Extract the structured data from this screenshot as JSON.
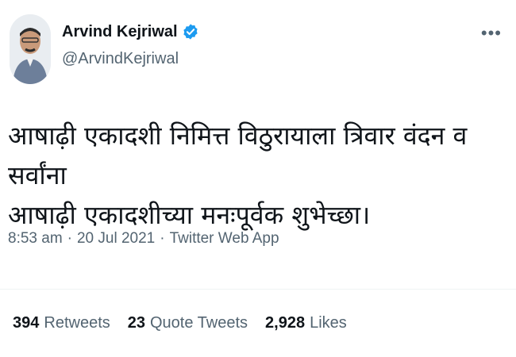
{
  "author": {
    "display_name": "Arvind Kejriwal",
    "handle": "@ArvindKejriwal",
    "verified": true,
    "verified_icon": "verified-badge-icon",
    "avatar_icon": "avatar"
  },
  "menu": {
    "more_icon": "more-horizontal-icon",
    "label": "•••"
  },
  "tweet": {
    "lines": [
      "आषाढ़ी एकादशी निमित्त विठुरायाला त्रिवार वंदन व सर्वांना",
      "आषाढ़ी एकादशीच्या मनःपूर्वक शुभेच्छा।"
    ]
  },
  "meta": {
    "time": "8:53 am",
    "sep1": "·",
    "date": "20 Jul 2021",
    "sep2": "·",
    "source": "Twitter Web App"
  },
  "stats": {
    "retweets": {
      "count": "394",
      "label": "Retweets"
    },
    "quote_tweets": {
      "count": "23",
      "label": "Quote Tweets"
    },
    "likes": {
      "count": "2,928",
      "label": "Likes"
    }
  },
  "colors": {
    "verified": "#1d9bf0",
    "secondary_text": "#536471",
    "primary_text": "#0f1419"
  }
}
